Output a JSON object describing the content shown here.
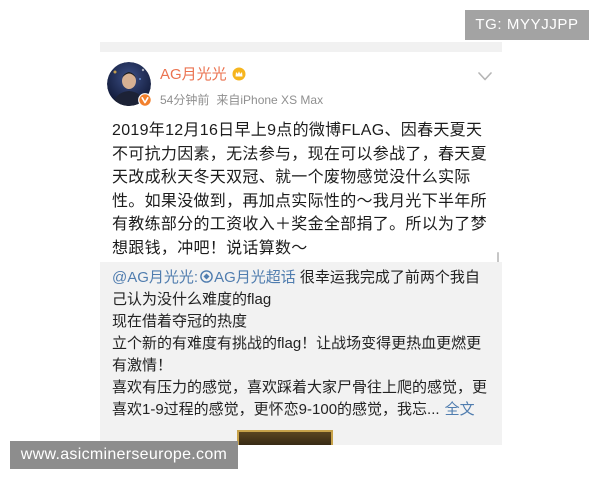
{
  "watermarks": {
    "top_right": "TG: MYYJJPP",
    "bottom_left": "www.asicminerseurope.com"
  },
  "post": {
    "author": "AG月光光",
    "time": "54分钟前",
    "source": "来自iPhone XS Max",
    "text_lines": [
      "2019年12月16日早上9点的微博FLAG、因春天夏天",
      "不可抗力因素，无法参与，现在可以参战了，春天夏",
      "天改成秋天冬天双冠、就一个废物感觉没什么实际",
      "性。如果没做到，再加点实际性的～我月光下半年所",
      "有教练部分的工资收入＋奖金全部捐了。所以为了梦",
      "想跟钱，冲吧！说话算数～"
    ]
  },
  "repost": {
    "author_mention": "@AG月光光:",
    "topic_mention": "AG月光超话",
    "first_line_rest": " 很幸运我完成了前两个我自",
    "lines": [
      "己认为没什么难度的flag",
      "现在借着夺冠的热度",
      "立个新的有难度有挑战的flag！让战场变得更热血更燃更",
      "有激情！",
      "喜欢有压力的感觉，喜欢踩着大家尸骨往上爬的感觉，更"
    ],
    "last_line": "喜欢1-9过程的感觉，更怀恋9-100的感觉，我忘...",
    "expand_label": "全文"
  },
  "icons": [
    "avatar",
    "verified-v-icon",
    "member-badge-icon",
    "chevron-down-icon",
    "super-topic-icon"
  ],
  "colors": {
    "author_name": "#eb7350",
    "link": "#507daf",
    "meta": "#8f8f8f",
    "repost_bg": "#f2f2f2",
    "verified": "#f2802d",
    "member_badge": "#f6b51e",
    "watermark_top_bg": "#a3a3a3",
    "watermark_bottom_bg": "#8d8d8d"
  }
}
